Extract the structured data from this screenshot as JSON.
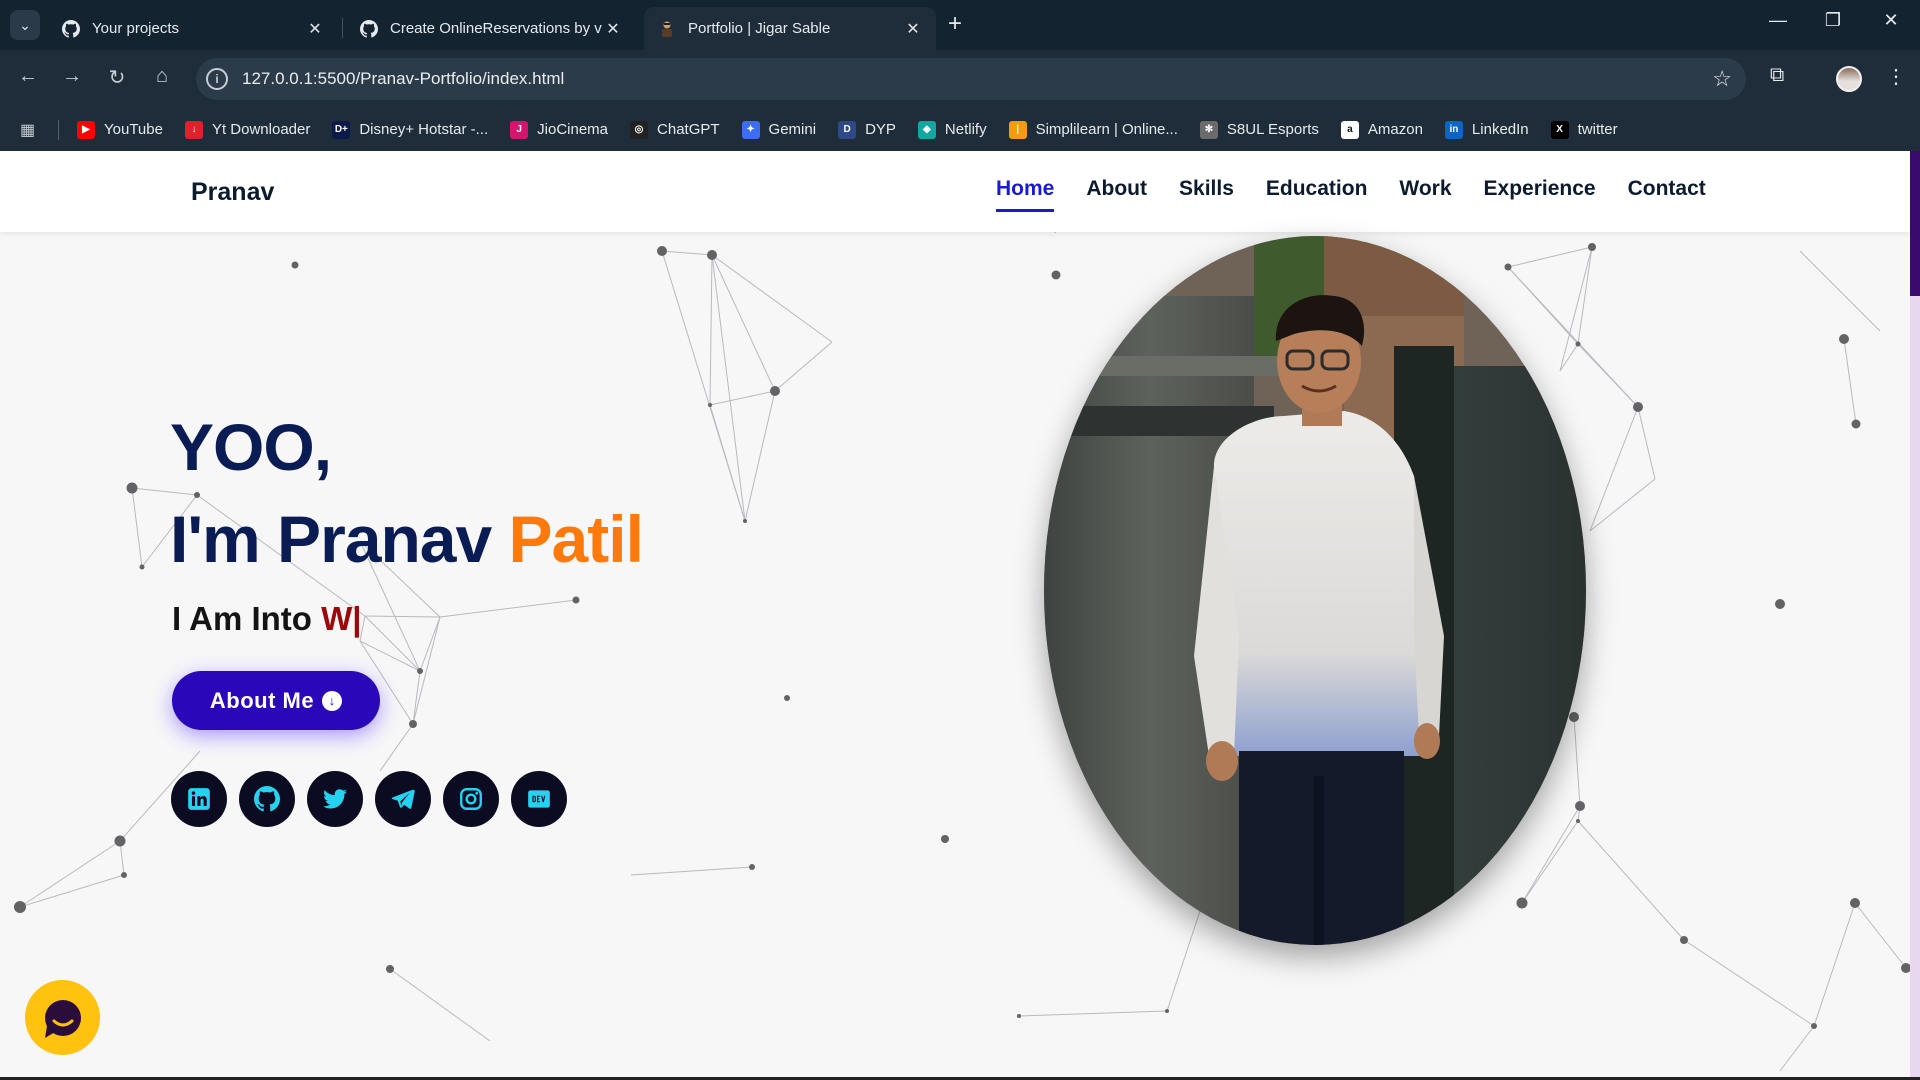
{
  "browser": {
    "tabs": [
      {
        "title": "Your projects",
        "icon": "github-icon"
      },
      {
        "title": "Create OnlineReservations by v",
        "icon": "github-icon"
      },
      {
        "title": "Portfolio | Jigar Sable",
        "icon": "portfolio-favicon",
        "active": true
      }
    ],
    "url": "127.0.0.1:5500/Pranav-Portfolio/index.html",
    "bookmarks": [
      {
        "label": "YouTube",
        "color": "#ff0000",
        "glyph": "▶"
      },
      {
        "label": "Yt Downloader",
        "color": "#e0202a",
        "glyph": "↓"
      },
      {
        "label": "Disney+ Hotstar -...",
        "color": "#0c1a4a",
        "glyph": "D+"
      },
      {
        "label": "JioCinema",
        "color": "#d4146e",
        "glyph": "J"
      },
      {
        "label": "ChatGPT",
        "color": "#222222",
        "glyph": "◎"
      },
      {
        "label": "Gemini",
        "color": "#3d6ef2",
        "glyph": "✦"
      },
      {
        "label": "DYP",
        "color": "#2d4a86",
        "glyph": "D"
      },
      {
        "label": "Netlify",
        "color": "#14a6a0",
        "glyph": "◆"
      },
      {
        "label": "Simplilearn | Online...",
        "color": "#f39c12",
        "glyph": "|"
      },
      {
        "label": "S8UL Esports",
        "color": "#6b6b6b",
        "glyph": "✻"
      },
      {
        "label": "Amazon",
        "color": "#ffffff",
        "glyph": "a"
      },
      {
        "label": "LinkedIn",
        "color": "#0a66c2",
        "glyph": "in"
      },
      {
        "label": "twitter",
        "color": "#000000",
        "glyph": "X"
      }
    ]
  },
  "site": {
    "brand": "Pranav",
    "nav": [
      "Home",
      "About",
      "Skills",
      "Education",
      "Work",
      "Experience",
      "Contact"
    ],
    "active_nav": "Home",
    "hero": {
      "greeting": "YOO,",
      "intro": "I'm Pranav ",
      "surname": "Patil",
      "typed_prefix": "I Am Into ",
      "typed_text": "W|",
      "button": "About Me"
    },
    "socials": [
      "linkedin-icon",
      "github-icon",
      "twitter-icon",
      "telegram-icon",
      "instagram-icon",
      "dev-icon"
    ],
    "colors": {
      "navy": "#0a1c54",
      "accent": "#ff7a0a",
      "button": "#2a07b8",
      "active_nav": "#1a1ad1"
    }
  }
}
